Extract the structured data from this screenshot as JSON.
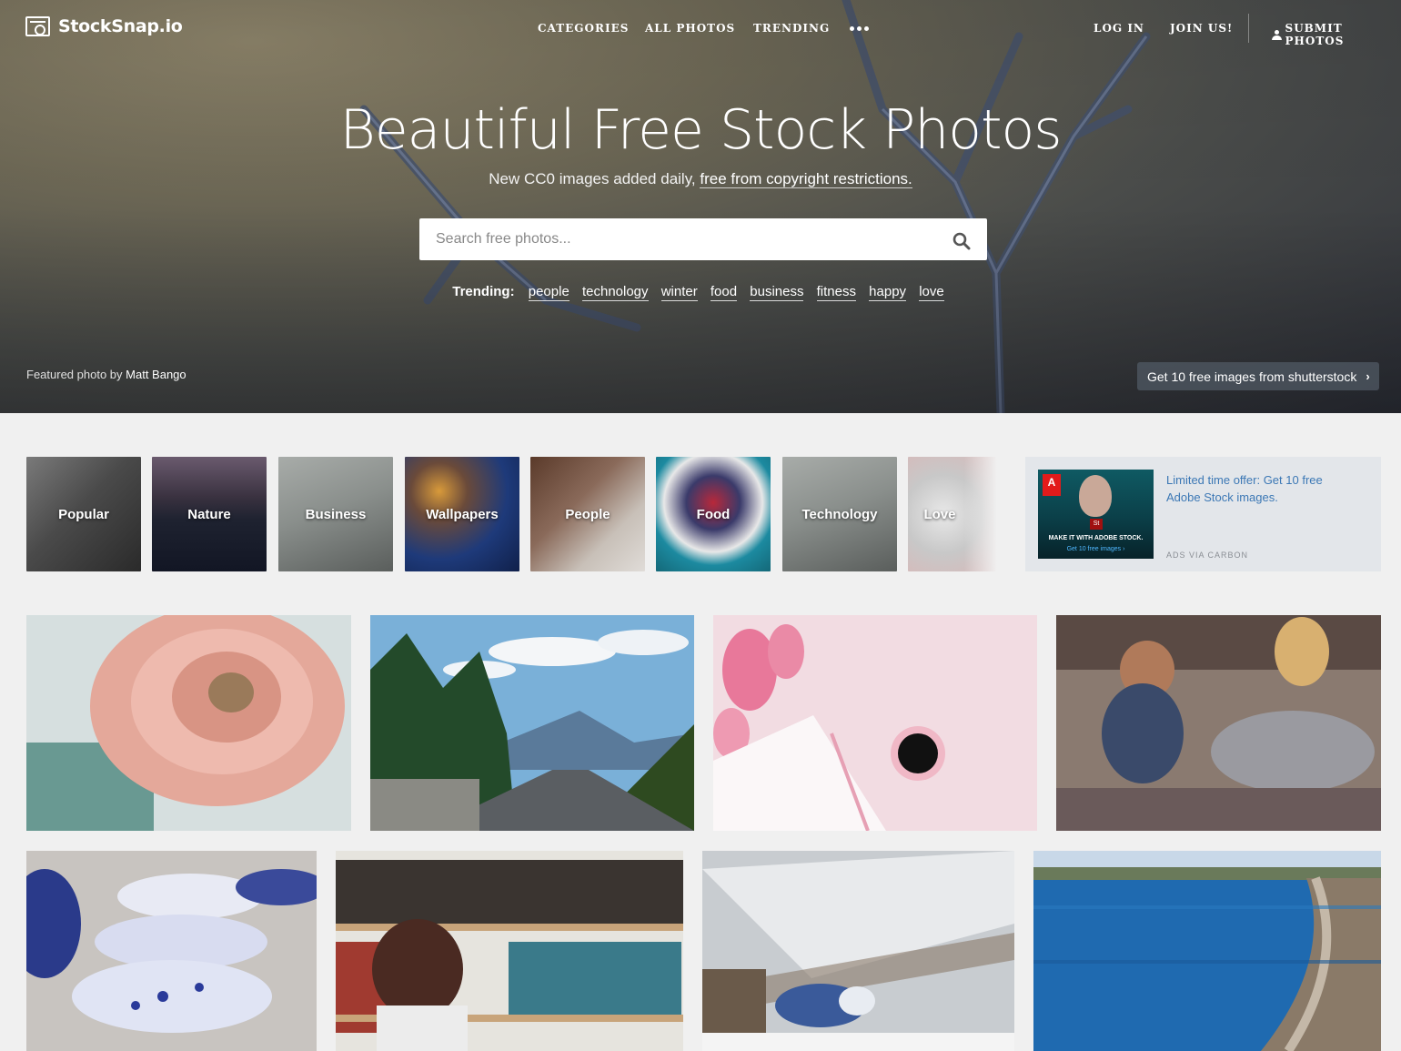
{
  "brand": {
    "name": "StockSnap.io"
  },
  "nav": {
    "categories": "CATEGORIES",
    "all_photos": "ALL PHOTOS",
    "trending": "TRENDING",
    "login": "LOG IN",
    "join": "JOIN US!",
    "submit": "SUBMIT PHOTOS"
  },
  "hero": {
    "title": "Beautiful Free Stock Photos",
    "subtitle_prefix": "New CC0 images added daily, ",
    "subtitle_link": "free from copyright restrictions.",
    "search_placeholder": "Search free photos...",
    "trending_label": "Trending:",
    "trending_tags": [
      "people",
      "technology",
      "winter",
      "food",
      "business",
      "fitness",
      "happy",
      "love"
    ],
    "featured_prefix": "Featured photo by",
    "featured_author": "Matt Bango",
    "shutterstock_cta": "Get 10 free images from shutterstock"
  },
  "categories": [
    "Popular",
    "Nature",
    "Business",
    "Wallpapers",
    "People",
    "Food",
    "Technology",
    "Love"
  ],
  "ad": {
    "copy": "Limited time offer: Get 10 free Adobe Stock images.",
    "image_line1": "MAKE IT WITH ADOBE STOCK.",
    "image_line2": "Get 10 free images ›",
    "image_logo": "A",
    "image_badge": "St",
    "via": "ADS VIA CARBON"
  },
  "photos": [
    "pink-ranunculus-flower",
    "mountain-road-forest",
    "tulips-notebook-coffee",
    "mother-baby-playing",
    "blue-white-bowls",
    "woman-bookshelf",
    "blue-jay-winter",
    "blue-lake-shoreline"
  ],
  "colors": {
    "accent_link": "#3c78b5",
    "page_bg": "#f0f0f0"
  }
}
